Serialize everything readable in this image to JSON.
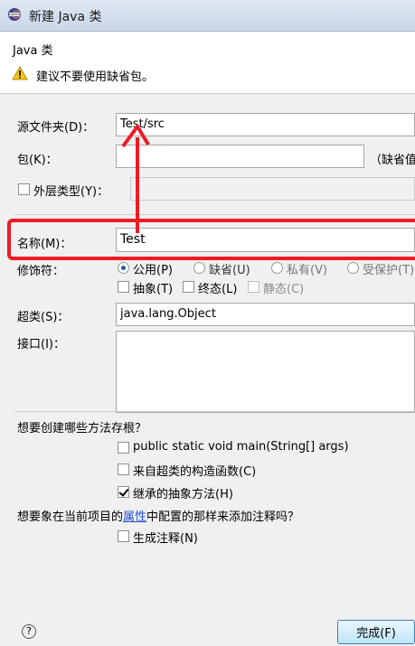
{
  "window": {
    "title": "新建 Java 类"
  },
  "header": {
    "title": "Java 类",
    "warning": "建议不要使用缺省包。"
  },
  "form": {
    "source_folder": {
      "label": "源文件夹(D)：",
      "value": "Test/src"
    },
    "package": {
      "label": "包(K)：",
      "value": "",
      "hint": "（缺省值"
    },
    "enclosing_type": {
      "label": "外层类型(Y)：",
      "value": ""
    },
    "name": {
      "label": "名称(M)：",
      "value": "Test"
    },
    "modifiers": {
      "label": "修饰符：",
      "access": [
        {
          "label": "公用(P)",
          "selected": true
        },
        {
          "label": "缺省(U)",
          "selected": false
        },
        {
          "label": "私有(V)",
          "selected": false
        },
        {
          "label": "受保护(T)",
          "selected": false
        }
      ],
      "flags": [
        {
          "label": "抽象(T)",
          "checked": false
        },
        {
          "label": "终态(L)",
          "checked": false
        },
        {
          "label": "静态(C)",
          "checked": false
        }
      ]
    },
    "superclass": {
      "label": "超类(S)：",
      "value": "java.lang.Object"
    },
    "interfaces": {
      "label": "接口(I)："
    },
    "stubs": {
      "question": "想要创建哪些方法存根？",
      "options": [
        {
          "label": "public static void main(String[] args)",
          "checked": false
        },
        {
          "label": "来自超类的构造函数(C)",
          "checked": false
        },
        {
          "label": "继承的抽象方法(H)",
          "checked": true
        }
      ]
    },
    "comments": {
      "question_before": "想要象在当前项目的",
      "question_link": "属性",
      "question_after": "中配置的那样来添加注释吗？",
      "option": {
        "label": "生成注释(N)",
        "checked": false
      }
    }
  },
  "footer": {
    "help": "?",
    "finish_label": "完成(F)"
  },
  "colors": {
    "highlight": "#ee1b24",
    "accent": "#1d5fa8"
  }
}
